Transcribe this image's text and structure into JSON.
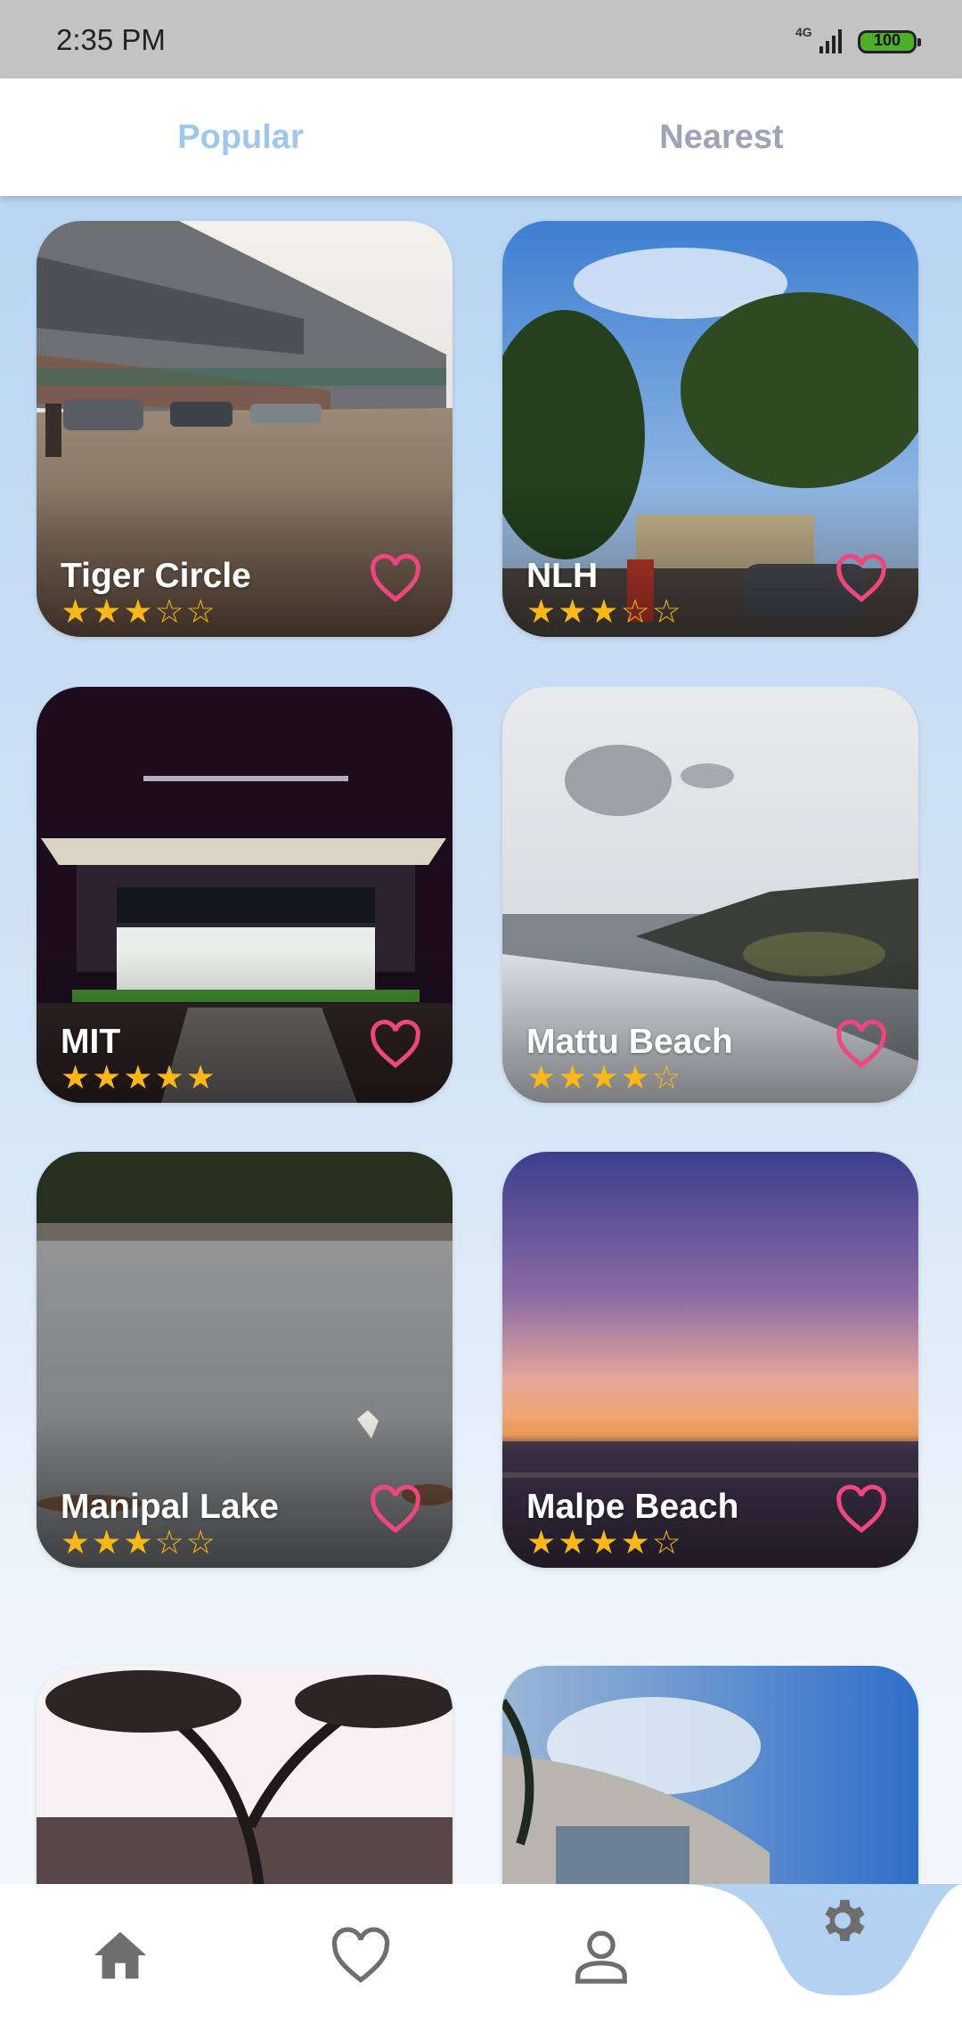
{
  "status_bar": {
    "time": "2:35 PM",
    "network": "4G",
    "battery": "100",
    "battery_color": "#4caf2a"
  },
  "tabs": [
    {
      "label": "Popular",
      "active": true
    },
    {
      "label": "Nearest",
      "active": false
    }
  ],
  "colors": {
    "accent": "#9ec7ee",
    "heart": "#f0467f",
    "star": "#f9b815",
    "nav_icon": "#6e6e6e"
  },
  "places": [
    {
      "name": "Tiger Circle",
      "rating": 3,
      "stars": "★★★☆☆"
    },
    {
      "name": "NLH",
      "rating": 3,
      "stars": "★★★☆☆"
    },
    {
      "name": "MIT",
      "rating": 5,
      "stars": "★★★★★"
    },
    {
      "name": "Mattu Beach",
      "rating": 4,
      "stars": "★★★★☆"
    },
    {
      "name": "Manipal Lake",
      "rating": 3,
      "stars": "★★★☆☆"
    },
    {
      "name": "Malpe Beach",
      "rating": 4,
      "stars": "★★★★☆"
    },
    {
      "name": "",
      "rating": null,
      "stars": ""
    },
    {
      "name": "",
      "rating": null,
      "stars": ""
    }
  ],
  "bottom_nav": [
    {
      "icon": "home-icon"
    },
    {
      "icon": "heart-icon"
    },
    {
      "icon": "person-icon"
    },
    {
      "icon": "gear-icon"
    }
  ]
}
